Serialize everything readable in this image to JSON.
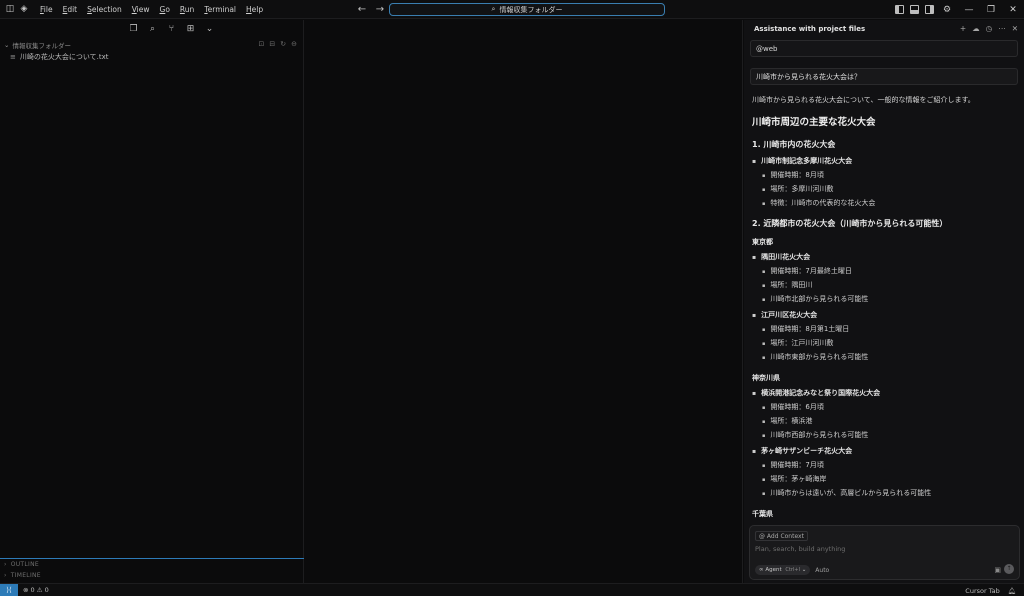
{
  "titlebar": {
    "menu": [
      "File",
      "Edit",
      "Selection",
      "View",
      "Go",
      "Run",
      "Terminal",
      "Help"
    ],
    "search_text": "情報収集フォルダー"
  },
  "sidebar": {
    "folder_name": "情報収集フォルダー",
    "file_name": "川崎の花火大会について.txt",
    "outline_label": "OUTLINE",
    "timeline_label": "TIMELINE"
  },
  "chat": {
    "title": "Assistance with project files",
    "web_chip": "@web",
    "question": "川崎市から見られる花火大会は？",
    "intro": "川崎市から見られる花火大会について、一般的な情報をご紹介します。",
    "heading": "川崎市周辺の主要な花火大会",
    "sections": [
      {
        "title": "1. 川崎市内の花火大会",
        "items": [
          {
            "name": "川崎市制記念多摩川花火大会",
            "details": [
              "開催時期：8月頃",
              "場所：多摩川河川敷",
              "特徴：川崎市の代表的な花火大会"
            ]
          }
        ]
      },
      {
        "title": "2. 近隣都市の花火大会（川崎市から見られる可能性）",
        "regions": [
          {
            "name": "東京都",
            "items": [
              {
                "name": "隅田川花火大会",
                "details": [
                  "開催時期：7月最終土曜日",
                  "場所：隅田川",
                  "川崎市北部から見られる可能性"
                ]
              },
              {
                "name": "江戸川区花火大会",
                "details": [
                  "開催時期：8月第1土曜日",
                  "場所：江戸川河川敷",
                  "川崎市東部から見られる可能性"
                ]
              }
            ]
          },
          {
            "name": "神奈川県",
            "items": [
              {
                "name": "横浜開港記念みなと祭り国際花火大会",
                "details": [
                  "開催時期：6月頃",
                  "場所：横浜港",
                  "川崎市西部から見られる可能性"
                ]
              },
              {
                "name": "茅ヶ崎サザンビーチ花火大会",
                "details": [
                  "開催時期：7月頃",
                  "場所：茅ヶ崎海岸",
                  "川崎市からは遠いが、高層ビルから見られる可能性"
                ]
              }
            ]
          },
          {
            "name": "千葉県"
          }
        ]
      }
    ],
    "composer": {
      "add_context": "Add Context",
      "placeholder": "Plan, search, build anything",
      "agent_label": "Agent",
      "agent_shortcut": "Ctrl+I",
      "auto_label": "Auto"
    }
  },
  "statusbar": {
    "errors": "0",
    "warnings": "0",
    "cursor_tab": "Cursor Tab"
  },
  "colors": {
    "accent": "#2d7bb8",
    "background": "#0b0b0c",
    "chat_background": "#111113"
  }
}
